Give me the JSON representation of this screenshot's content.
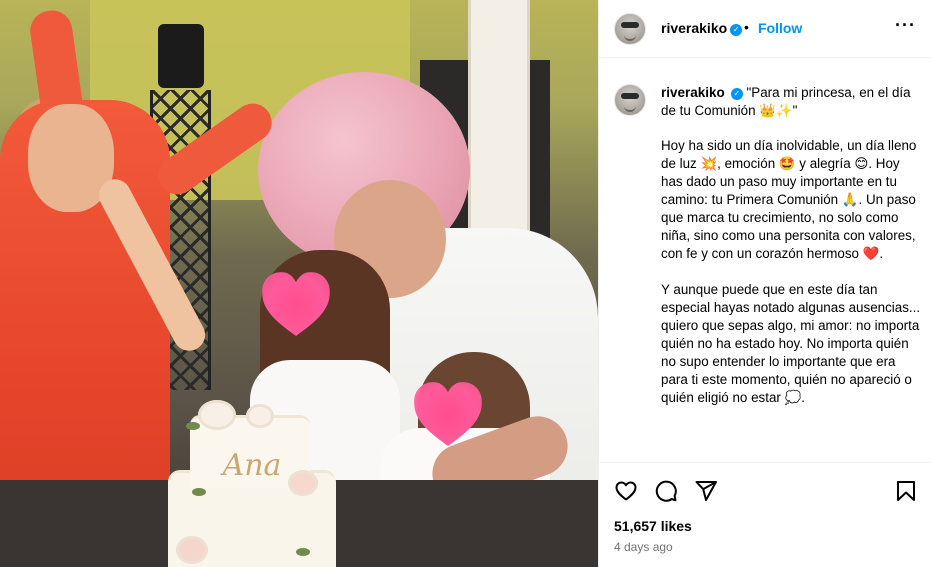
{
  "header": {
    "username": "riverakiko",
    "separator": "•",
    "follow_label": "Follow",
    "more_icon": "more-horizontal-icon"
  },
  "photo": {
    "cake_text": "Ana",
    "description_icons": [
      "heart-privacy-sticker-icon"
    ]
  },
  "caption": {
    "username": "riverakiko",
    "first_line": "\"Para mi princesa, en el día de tu Comunión 👑✨\"",
    "paragraphs": [
      "Hoy ha sido un día inolvidable, un día lleno de luz 💥, emoción 🤩 y alegría 😊. Hoy has dado un paso muy importante en tu camino: tu Primera Comunión 🙏. Un paso que marca tu crecimiento, no solo como niña, sino como una personita con valores, con fe y con un corazón hermoso ❤️.",
      "Y aunque puede que en este día tan especial hayas notado algunas ausencias... quiero que sepas algo, mi amor: no importa quién no ha estado hoy. No importa quién no supo entender lo importante que era para ti este momento, quién no apareció o quién eligió no estar 💭."
    ]
  },
  "actions": {
    "icons": [
      "heart-icon",
      "comment-icon",
      "share-icon",
      "bookmark-icon"
    ],
    "likes": "51,657 likes",
    "date": "4 days ago"
  },
  "colors": {
    "accent": "#0095f6",
    "muted": "#737373",
    "border": "#efefef"
  }
}
